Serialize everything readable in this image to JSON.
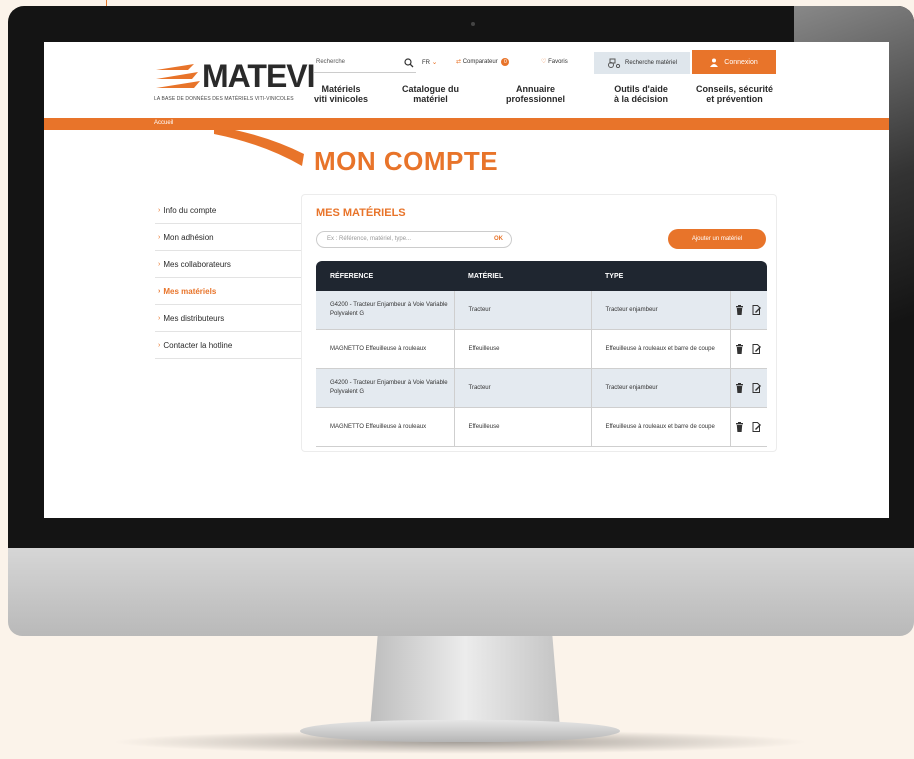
{
  "header": {
    "logo_text": "MATEVI",
    "logo_tagline": "LA BASE DE DONNÉES DES MATÉRIELS VITI-VINICOLES",
    "search_label": "Recherche",
    "lang": "FR",
    "comparer_label": "Comparateur",
    "comparer_count": "0",
    "favorites_label": "Favoris",
    "search_material_label": "Recherche matériel",
    "connect_label": "Connexion"
  },
  "nav": [
    {
      "label": "Matériels\nviti vinicoles"
    },
    {
      "label": "Catalogue du\nmatériel"
    },
    {
      "label": "Annuaire\nprofessionnel"
    },
    {
      "label": "Outils d'aide\nà la décision"
    },
    {
      "label": "Conseils, sécurité\net prévention"
    }
  ],
  "breadcrumb": "Accueil",
  "page_title": "MON COMPTE",
  "sidebar": {
    "items": [
      {
        "label": "Info du compte"
      },
      {
        "label": "Mon adhésion"
      },
      {
        "label": "Mes collaborateurs"
      },
      {
        "label": "Mes matériels"
      },
      {
        "label": "Mes distributeurs"
      },
      {
        "label": "Contacter la hotline"
      }
    ],
    "active_index": 3
  },
  "panel": {
    "title": "MES MATÉRIELS",
    "filter_placeholder": "Ex : Référence, matériel, type...",
    "filter_ok": "OK",
    "add_button": "Ajouter un matériel"
  },
  "table": {
    "headers": [
      "RÉFERENCE",
      "MATÉRIEL",
      "TYPE",
      ""
    ],
    "rows": [
      {
        "reference": "G4200 - Tracteur Enjambeur à Voie Variable Polyvalent G",
        "materiel": "Tracteur",
        "type": "Tracteur enjambeur"
      },
      {
        "reference": "MAGNETTO Effeuilleuse à rouleaux",
        "materiel": "Effeuilleuse",
        "type": "Effeuilleuse à rouleaux et barre de coupe"
      },
      {
        "reference": "G4200 - Tracteur Enjambeur à Voie Variable Polyvalent G",
        "materiel": "Tracteur",
        "type": "Tracteur enjambeur"
      },
      {
        "reference": "MAGNETTO Effeuilleuse à rouleaux",
        "materiel": "Effeuilleuse",
        "type": "Effeuilleuse à rouleaux et barre de coupe"
      }
    ]
  },
  "colors": {
    "accent": "#e8742a",
    "table_header": "#1f2630",
    "row_alt": "#e4eaf0"
  }
}
